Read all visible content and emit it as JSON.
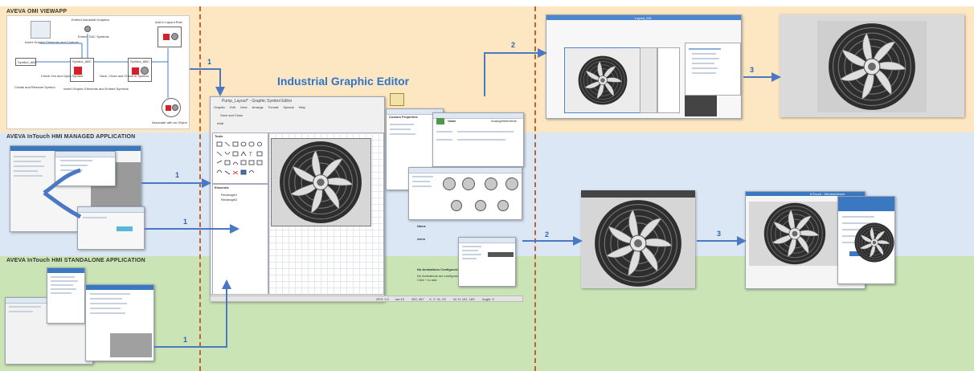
{
  "lanes": {
    "omi": "AVEVA OMI VIEWAPP",
    "managed": "AVEVA InTouch HMI MANAGED APPLICATION",
    "standalone": "AVEVA InTouch HMI STANDALONE APPLICATION"
  },
  "editor_title": "Industrial Graphic Editor",
  "omi_workflow": {
    "embed_graphics": "Embed Industrial Graphics",
    "insert_graphic": "Insert Graphic Elements and Controls",
    "embed_sac": "Embed SAC Symbols",
    "add_layout": "Add to Layout Row",
    "symbol_1": "Symbol_ABC",
    "symbol_2": "Symbol_ABC",
    "symbol_3": "Symbol_ABC",
    "create_rename": "Create and Rename Symbol",
    "check_out": "Check Out and Open Symbol",
    "insert_embed": "Insert Graphic Elements and Embed Symbols",
    "save_close": "Save, Close and Check In Symbol",
    "associate": "Associate with an Object"
  },
  "editor": {
    "window_title": "Pump_Layout* - Graphic Symbol Editor",
    "menu": [
      "Graphic",
      "Edit",
      "View",
      "Arrange",
      "Format",
      "Special",
      "Help"
    ],
    "save_close": "Save and Close",
    "font": "Arial",
    "tools_label": "Tools",
    "elements_label": "Elements",
    "tree": [
      "Rectangle1",
      "Rectangle2"
    ],
    "status": "Double click the 'Rectangle1' Rectangle to add animations.",
    "status_fields": [
      "GFX: 0.2",
      "sm:10",
      "453, 367",
      "X, Y: 31, 23",
      "W, H: 151, 183",
      "Angle: 0"
    ],
    "animations": "No Animations Configured",
    "animations_hint": "No Animations are configured. Click + to add.",
    "props": "Custom Properties",
    "value_label": "Value",
    "analog_meter": "AnalogMeterWide",
    "name_label": "Name",
    "anim_label": "Anim"
  },
  "steps": {
    "s1_omi": "1",
    "s2_omi": "2",
    "s3_omi": "3",
    "s1_managed": "1",
    "s1_managed_b": "1",
    "s2_managed": "2",
    "s3_managed": "3",
    "s1_standalone": "1"
  },
  "omi_screen": {
    "title": "Layout_001"
  },
  "managed_screen": {
    "title": "InTouch - Windowviewer"
  },
  "colors": {
    "omi_band": "#fde6c2",
    "managed_band": "#dbe7f4",
    "standalone_band": "#cbe4b6",
    "arrow": "#4a78c3",
    "divider": "#c0632b",
    "title": "#2e74c8"
  }
}
